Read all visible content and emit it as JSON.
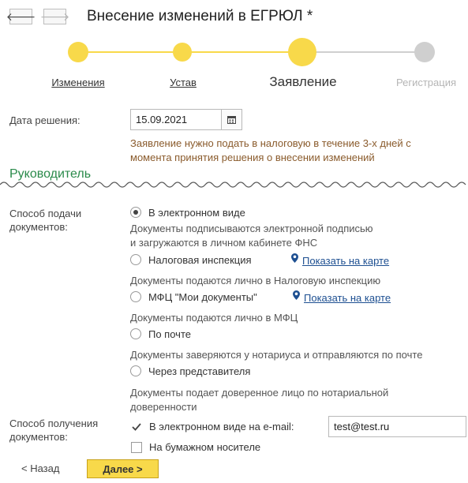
{
  "header": {
    "back_icon": "arrow-left",
    "forward_icon": "arrow-right",
    "title": "Внесение изменений в ЕГРЮЛ *"
  },
  "steps": [
    {
      "label": "Изменения",
      "state": "done"
    },
    {
      "label": "Устав",
      "state": "done"
    },
    {
      "label": "Заявление",
      "state": "current"
    },
    {
      "label": "Регистрация",
      "state": "future"
    }
  ],
  "colors": {
    "accent": "#f8d94a",
    "future": "#cccccc",
    "section": "#2a8a4a",
    "hint": "#8a5b2c",
    "link": "#1d4f91"
  },
  "decision": {
    "label": "Дата решения:",
    "value": "15.09.2021",
    "hint_line1": "Заявление нужно подать в налоговую в течение 3-х дней с",
    "hint_line2": "момента принятия решения о внесении изменений"
  },
  "section": {
    "title": "Руководитель"
  },
  "submission": {
    "label_line1": "Способ подачи",
    "label_line2": "документов:",
    "options": [
      {
        "label": "В электронном виде",
        "selected": true,
        "note_line1": "Документы подписываются электронной подписью",
        "note_line2": "и загружаются в личном кабинете ФНС"
      },
      {
        "label": "Налоговая инспекция",
        "selected": false,
        "map_link": "Показать на карте",
        "note_line1": "Документы подаются лично в Налоговую инспекцию"
      },
      {
        "label": "МФЦ \"Мои документы\"",
        "selected": false,
        "map_link": "Показать на карте",
        "note_line1": "Документы подаются лично в МФЦ"
      },
      {
        "label": "По почте",
        "selected": false,
        "note_line1": "Документы заверяются у нотариуса и отправляются по почте"
      },
      {
        "label": "Через представителя",
        "selected": false,
        "note_line1": "Документы подает доверенное лицо по нотариальной",
        "note_line2": "доверенности"
      }
    ]
  },
  "receipt": {
    "label_line1": "Способ получения",
    "label_line2": "документов:",
    "electronic_label": "В электронном виде на e-mail:",
    "electronic_checked": true,
    "email": "test@test.ru",
    "paper_label": "На бумажном носителе",
    "paper_checked": false
  },
  "footer": {
    "back_label": "< Назад",
    "next_label": "Далее >"
  }
}
